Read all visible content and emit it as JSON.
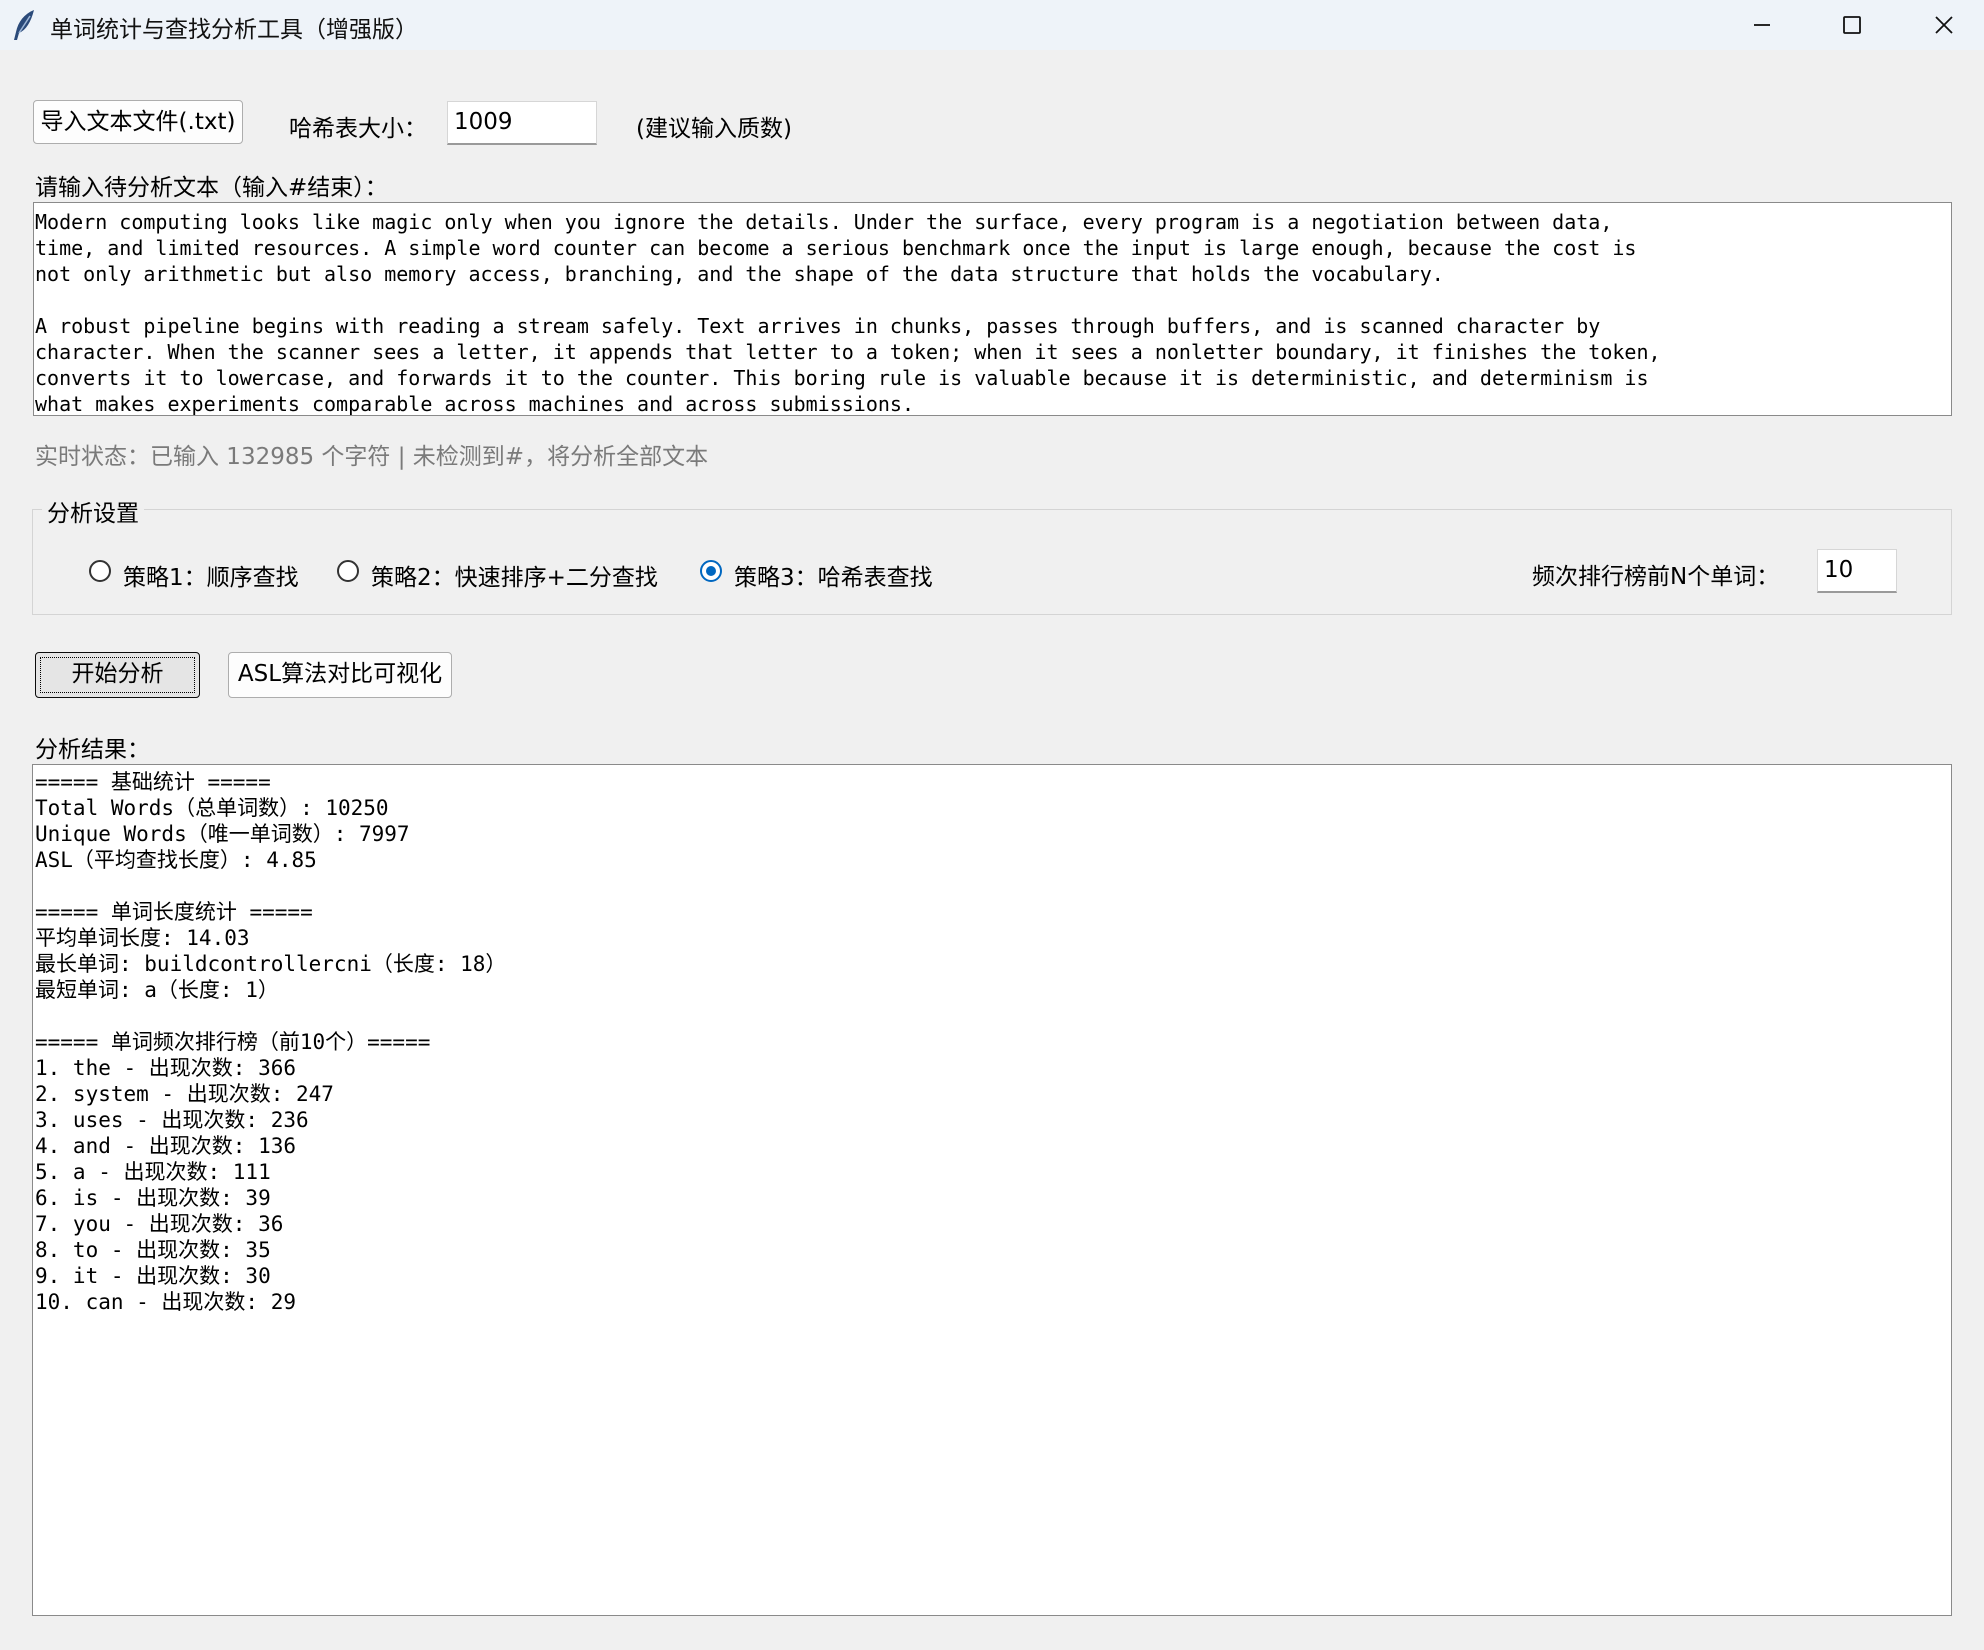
{
  "window": {
    "title": "单词统计与查找分析工具（增强版）",
    "controls": [
      "minimize-icon",
      "maximize-icon",
      "close-icon"
    ],
    "app_icon": "feather-icon"
  },
  "toolbar": {
    "import_button": "导入文本文件(.txt)",
    "hash_size_label": "哈希表大小：",
    "hash_size_value": "1009",
    "hash_size_hint": "(建议输入质数)"
  },
  "input": {
    "label": "请输入待分析文本（输入#结束）：",
    "text": "Modern computing looks like magic only when you ignore the details. Under the surface, every program is a negotiation between data,\ntime, and limited resources. A simple word counter can become a serious benchmark once the input is large enough, because the cost is\nnot only arithmetic but also memory access, branching, and the shape of the data structure that holds the vocabulary.\n\nA robust pipeline begins with reading a stream safely. Text arrives in chunks, passes through buffers, and is scanned character by\ncharacter. When the scanner sees a letter, it appends that letter to a token; when it sees a nonletter boundary, it finishes the token,\nconverts it to lowercase, and forwards it to the counter. This boring rule is valuable because it is deterministic, and determinism is\nwhat makes experiments comparable across machines and across submissions."
  },
  "status": {
    "text": "实时状态：已输入 132985 个字符 | 未检测到#，将分析全部文本"
  },
  "settings": {
    "group_title": "分析设置",
    "strategies": [
      {
        "label": "策略1：顺序查找",
        "selected": false
      },
      {
        "label": "策略2：快速排序+二分查找",
        "selected": false
      },
      {
        "label": "策略3：哈希表查找",
        "selected": true
      }
    ],
    "topn_label": "频次排行榜前N个单词：",
    "topn_value": "10"
  },
  "actions": {
    "start_button": "开始分析",
    "visualize_button": "ASL算法对比可视化"
  },
  "results": {
    "label": "分析结果：",
    "text": "===== 基础统计 =====\nTotal Words（总单词数）: 10250\nUnique Words（唯一单词数）: 7997\nASL（平均查找长度）: 4.85\n\n===== 单词长度统计 =====\n平均单词长度: 14.03\n最长单词: buildcontrollercni（长度: 18）\n最短单词: a（长度: 1）\n\n===== 单词频次排行榜（前10个）=====\n1. the - 出现次数: 366\n2. system - 出现次数: 247\n3. uses - 出现次数: 236\n4. and - 出现次数: 136\n5. a - 出现次数: 111\n6. is - 出现次数: 39\n7. you - 出现次数: 36\n8. to - 出现次数: 35\n9. it - 出现次数: 30\n10. can - 出现次数: 29"
  },
  "colors": {
    "accent": "#0067c0",
    "window_bg": "#f0f0f0",
    "titlebar_bg": "#eef3f9",
    "status_text": "#7a7a7a"
  }
}
